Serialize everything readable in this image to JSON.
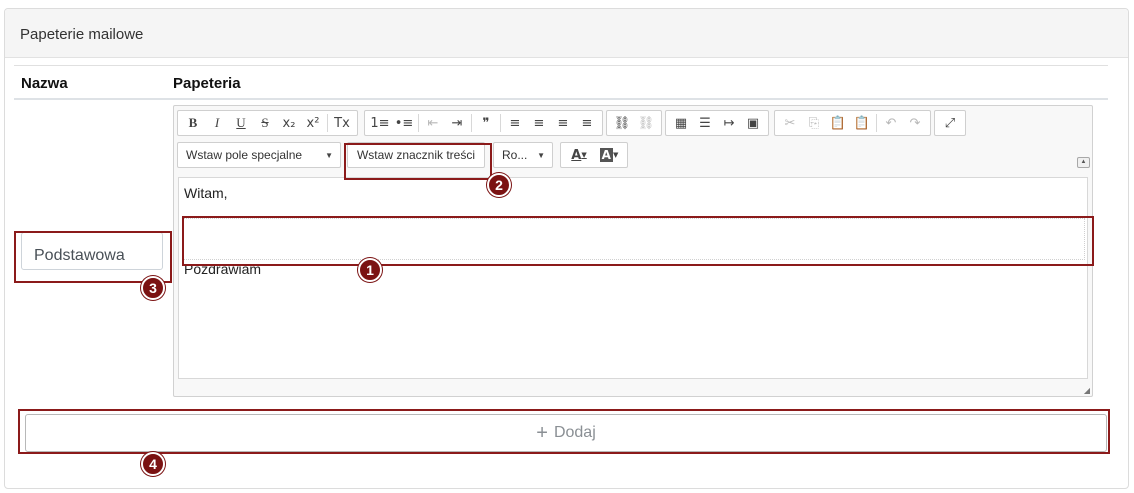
{
  "card": {
    "title": "Papeterie mailowe"
  },
  "table": {
    "col_name": "Nazwa",
    "col_stationery": "Papeteria"
  },
  "row": {
    "name_value": "Podstawowa"
  },
  "toolbar": {
    "row1_groups": [
      [
        {
          "g": "B",
          "n": "bold-icon"
        },
        {
          "g": "I",
          "n": "italic-icon"
        },
        {
          "g": "U",
          "n": "underline-icon"
        },
        {
          "g": "S",
          "n": "strikethrough-icon"
        },
        {
          "g": "x₂",
          "n": "subscript-icon"
        },
        {
          "g": "x²",
          "n": "superscript-icon"
        },
        {
          "sep": true
        },
        {
          "g": "Tx",
          "n": "remove-format-icon"
        }
      ],
      [
        {
          "g": "1≡",
          "n": "numbered-list-icon"
        },
        {
          "g": "•≡",
          "n": "bulleted-list-icon"
        },
        {
          "sep": true
        },
        {
          "g": "⇤",
          "n": "decrease-indent-icon",
          "dim": true
        },
        {
          "g": "⇥",
          "n": "increase-indent-icon"
        },
        {
          "sep": true
        },
        {
          "g": "❞",
          "n": "blockquote-icon"
        },
        {
          "sep": true
        },
        {
          "g": "≡",
          "n": "align-left-icon"
        },
        {
          "g": "≡",
          "n": "align-center-icon"
        },
        {
          "g": "≡",
          "n": "align-right-icon"
        },
        {
          "g": "≡",
          "n": "align-justify-icon"
        }
      ],
      [
        {
          "g": "⛓",
          "n": "link-icon"
        },
        {
          "g": "⛓",
          "n": "unlink-icon",
          "dim": true
        }
      ],
      [
        {
          "g": "▦",
          "n": "table-icon"
        },
        {
          "g": "☰",
          "n": "horizontal-line-icon"
        },
        {
          "g": "↦",
          "n": "page-break-icon"
        },
        {
          "g": "▣",
          "n": "image-icon"
        }
      ],
      [
        {
          "g": "✂",
          "n": "cut-icon",
          "dim": true
        },
        {
          "g": "⎘",
          "n": "copy-icon",
          "dim": true
        },
        {
          "g": "📋",
          "n": "paste-icon"
        },
        {
          "g": "📋",
          "n": "paste-text-icon"
        },
        {
          "sep": true
        },
        {
          "g": "↶",
          "n": "undo-icon",
          "dim": true
        },
        {
          "g": "↷",
          "n": "redo-icon",
          "dim": true
        }
      ],
      [
        {
          "g": "⤢",
          "n": "maximize-icon"
        }
      ]
    ],
    "special_field_label": "Wstaw pole specjalne",
    "content_marker_label": "Wstaw znacznik treści",
    "font_size_label": "Ro...",
    "text_color_glyph": "A",
    "bg_color_glyph": "A"
  },
  "editor_content": {
    "line1": "Witam,",
    "line2": "Pozdrawiam"
  },
  "add_button": {
    "label": "Dodaj",
    "icon": "plus-icon"
  },
  "annotations": [
    "1",
    "2",
    "3",
    "4"
  ],
  "colors": {
    "annotation": "#8b1a1a",
    "badge": "#7b1212",
    "header_bg": "#f5f5f5"
  }
}
